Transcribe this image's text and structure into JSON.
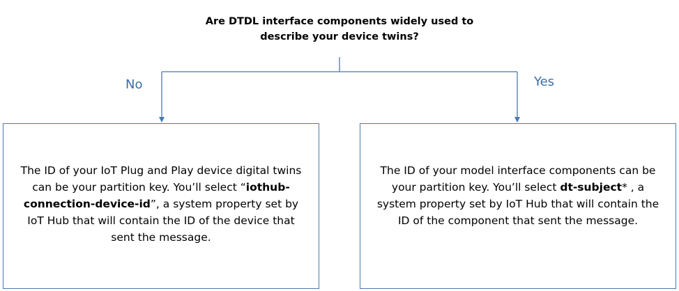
{
  "question": {
    "line1": "Are DTDL interface components widely used to",
    "line2": "describe your device twins?"
  },
  "branches": {
    "no_label": "No",
    "yes_label": "Yes"
  },
  "left_box": {
    "text_before": "The ID of your IoT Plug and Play device digital twins can be your partition key. You’ll select ",
    "open_quote": "“",
    "bold_term": "iothub-connection-device-id",
    "text_after": "”, a system property set by IoT Hub that will contain the ID of the device that sent the message."
  },
  "right_box": {
    "text_before": "The ID of your model interface components can be your partition key. You’ll select ",
    "bold_term": "dt-subject",
    "text_after": "* , a system property set by IoT Hub that will contain the ID of the component that sent the message."
  },
  "colors": {
    "connector": "#4a78b0",
    "box_border": "#4a78b0",
    "branch_label": "#3b6fa6"
  }
}
